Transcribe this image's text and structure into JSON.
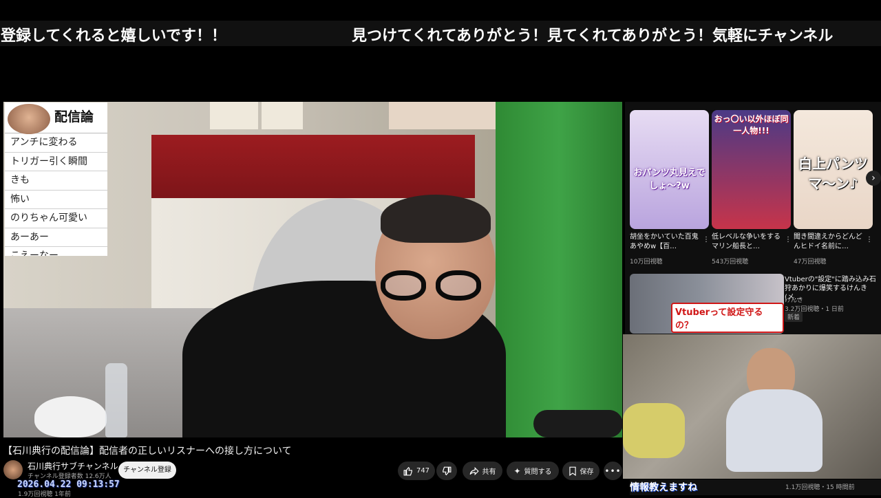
{
  "ticker": {
    "text_left": "登録してくれると嬉しいです！！",
    "text_right": "見つけてくれてありがとう！見てくれてありがとう！気軽にチャンネル"
  },
  "comment_overlay": {
    "title": "配信論",
    "items": [
      "アンチに変わる",
      "トリガー引く瞬間",
      "きも",
      "怖い",
      "のりちゃん可愛い",
      "あーあー",
      "こえーなー"
    ]
  },
  "video": {
    "title": "【石川典行の配信論】配信者の正しいリスナーへの接し方について",
    "channel_name": "石川典行サブチャンネル",
    "channel_subs": "チャンネル登録者数 12.6万人",
    "subscribe_label": "チャンネル登録",
    "like_count": "747",
    "share_label": "共有",
    "ask_label": "質問する",
    "save_label": "保存",
    "timestamp_overlay": "2026.04.22  09:13:57",
    "views_partial": "1.9万回視聴 1年前"
  },
  "shorts": [
    {
      "caption": "おパンツ丸見えでしょ～?w",
      "title": "胡坐をかいていた百鬼あやめw【百…",
      "views": "10万回視聴",
      "bg": "#d9c9ef"
    },
    {
      "caption": "おっ〇い以外ほぼ同一人物!!!",
      "title": "低レベルな争いをするマリン船長と…",
      "views": "543万回視聴",
      "bg": "#3b2a6b"
    },
    {
      "caption": "白上パンツマ～ン♪",
      "title": "聞き間違えからどんどんヒドイ名前に…",
      "views": "47万回視聴",
      "bg": "#f2e6d9"
    }
  ],
  "recommended": {
    "thumb_caption": "Vtuberって設定守るの？",
    "title": "Vtuberの\"設定\"に踏み込み石狩あかりに爆笑するけんき(メ…",
    "channel": "けんき",
    "meta": "3.2万回視聴・1 日前",
    "badge": "新着"
  },
  "bottom_card": {
    "caption": "情報教えますね",
    "meta": "1.1万回視聴・15 時間前"
  },
  "icons": {
    "like": "thumb-up-icon",
    "dislike": "thumb-down-icon",
    "share": "share-icon",
    "ask": "sparkle-icon",
    "save": "bookmark-icon",
    "more": "more-horizontal-icon",
    "next": "chevron-right-icon",
    "kebab": "more-vertical-icon"
  }
}
